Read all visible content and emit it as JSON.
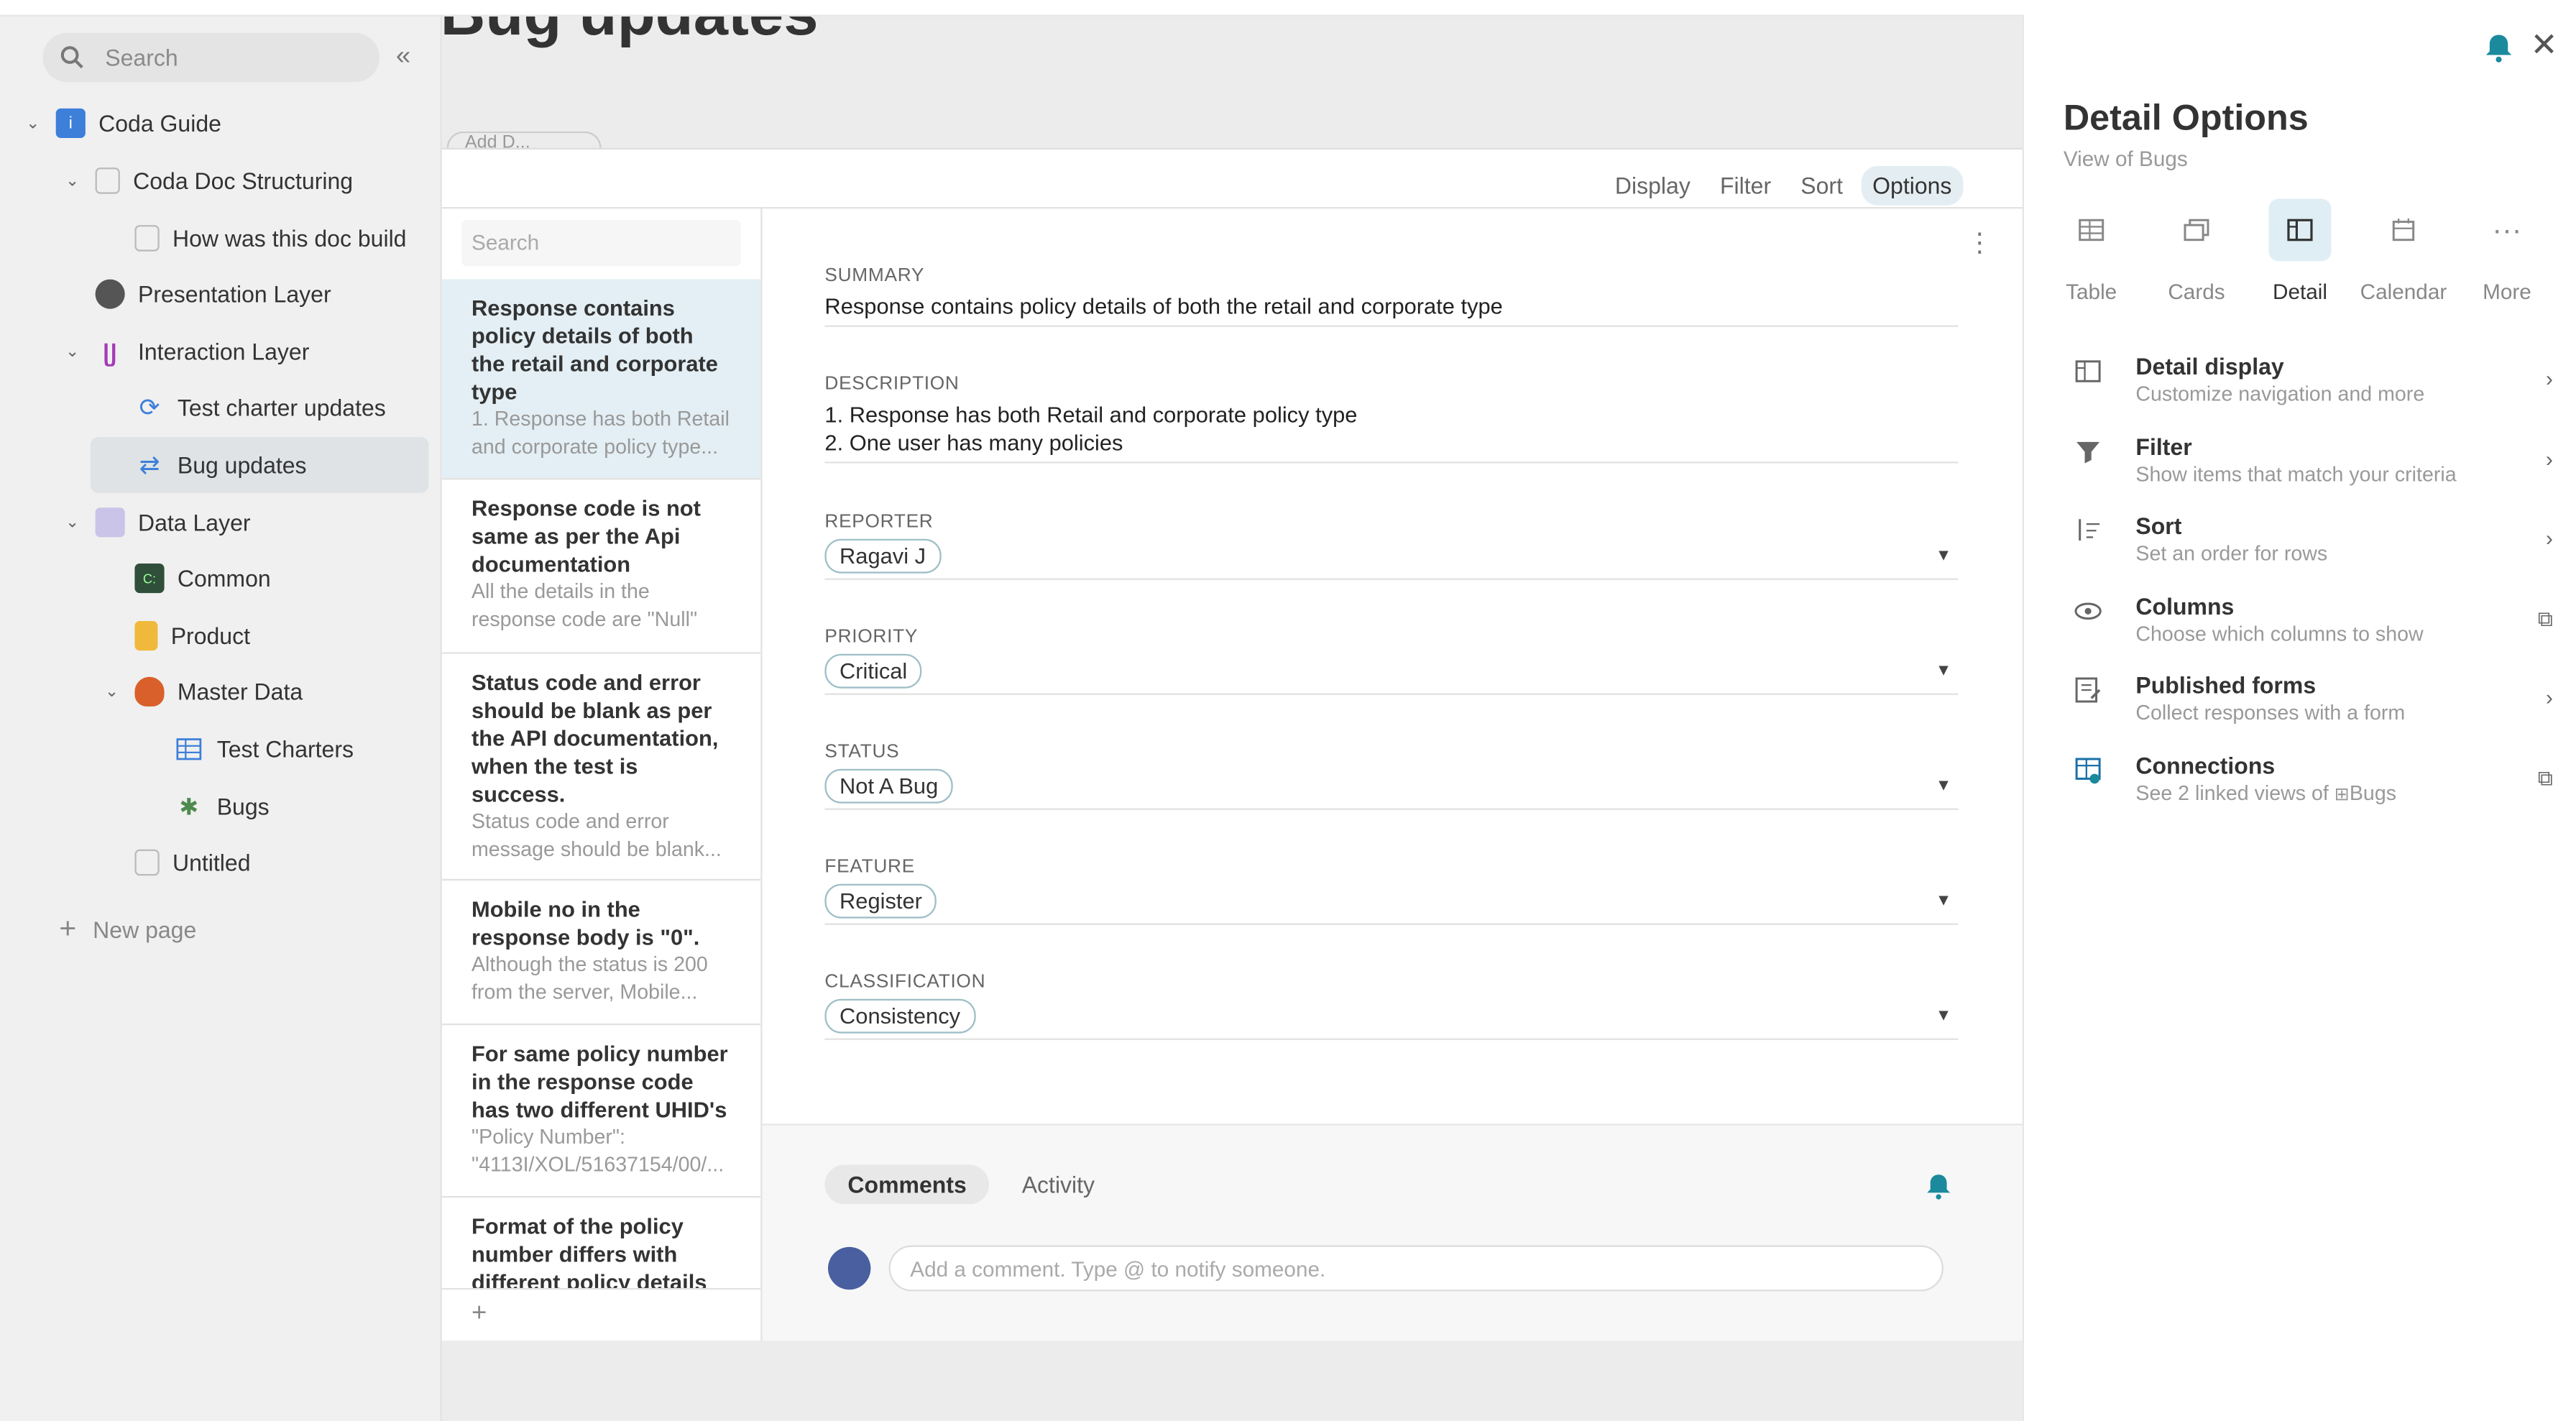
{
  "sidebar": {
    "search_placeholder": "Search",
    "collapse_glyph": "«",
    "new_page": "New page",
    "items": [
      {
        "label": "Coda Guide",
        "icon": "info-icon"
      },
      {
        "label": "Coda Doc Structuring",
        "icon": "doc-icon"
      },
      {
        "label": "How was this doc build",
        "icon": "doc-icon"
      },
      {
        "label": "Presentation Layer",
        "icon": "gauge-icon"
      },
      {
        "label": "Interaction Layer",
        "icon": "wave-icon"
      },
      {
        "label": "Test charter updates",
        "icon": "sync-icon"
      },
      {
        "label": "Bug updates",
        "icon": "sync-icon"
      },
      {
        "label": "Data Layer",
        "icon": "data-icon"
      },
      {
        "label": "Common",
        "icon": "terminal-icon"
      },
      {
        "label": "Product",
        "icon": "file-icon"
      },
      {
        "label": "Master Data",
        "icon": "fox-icon"
      },
      {
        "label": "Test Charters",
        "icon": "table-icon"
      },
      {
        "label": "Bugs",
        "icon": "bug-icon"
      },
      {
        "label": "Untitled",
        "icon": "doc-icon"
      }
    ]
  },
  "page": {
    "title": "Bug updates",
    "add_desc": "Add D..."
  },
  "toolbar": {
    "display": "Display",
    "filter": "Filter",
    "sort": "Sort",
    "options": "Options"
  },
  "list": {
    "search_placeholder": "Search",
    "add": "+",
    "cards": [
      {
        "title": "Response contains policy details of both the retail and corporate type",
        "desc": "1. Response has both Retail and corporate policy type..."
      },
      {
        "title": "Response code is not same as per the Api documentation",
        "desc": "All the details in the response code are \"Null\""
      },
      {
        "title": "Status code and error should be blank as per the API documentation, when the test is success.",
        "desc": "Status code and error message should be blank..."
      },
      {
        "title": "Mobile no in the response body is \"0\".",
        "desc": "Although the status is 200 from the server, Mobile..."
      },
      {
        "title": "For same policy number in the response code has two different UHID's",
        "desc": "\"Policy Number\": \"4113I/XOL/51637154/00/..."
      },
      {
        "title": "Format of the policy number differs with different policy details",
        "desc": ""
      }
    ]
  },
  "detail": {
    "summary_label": "SUMMARY",
    "summary": "Response contains policy details of both the retail and corporate type",
    "description_label": "DESCRIPTION",
    "description_1": "1. Response has both Retail and corporate policy type",
    "description_2": "2. One user has many policies",
    "reporter_label": "REPORTER",
    "reporter": "Ragavi J",
    "priority_label": "PRIORITY",
    "priority": "Critical",
    "status_label": "STATUS",
    "status": "Not A Bug",
    "feature_label": "FEATURE",
    "feature": "Register",
    "classification_label": "CLASSIFICATION",
    "classification": "Consistency"
  },
  "comments": {
    "tab_comments": "Comments",
    "tab_activity": "Activity",
    "placeholder": "Add a comment. Type @ to notify someone."
  },
  "panel": {
    "title": "Detail Options",
    "subtitle": "View of Bugs",
    "views": [
      {
        "label": "Table",
        "icon": "table-icon"
      },
      {
        "label": "Cards",
        "icon": "cards-icon"
      },
      {
        "label": "Detail",
        "icon": "detail-icon"
      },
      {
        "label": "Calendar",
        "icon": "calendar-icon"
      },
      {
        "label": "More",
        "icon": "more-icon"
      }
    ],
    "options": [
      {
        "title": "Detail display",
        "sub": "Customize navigation and more",
        "icon": "layout-icon",
        "arrow": "chevron-right-icon"
      },
      {
        "title": "Filter",
        "sub": "Show items that match your criteria",
        "icon": "filter-icon",
        "arrow": "chevron-right-icon"
      },
      {
        "title": "Sort",
        "sub": "Set an order for rows",
        "icon": "sort-icon",
        "arrow": "chevron-right-icon"
      },
      {
        "title": "Columns",
        "sub": "Choose which columns to show",
        "icon": "eye-icon",
        "arrow": "external-link-icon"
      },
      {
        "title": "Published forms",
        "sub": "Collect responses with a form",
        "icon": "form-icon",
        "arrow": "chevron-right-icon"
      },
      {
        "title": "Connections",
        "sub": "See 2 linked views of",
        "sub_link": "Bugs",
        "icon": "connections-icon",
        "arrow": "external-link-icon"
      }
    ]
  },
  "colors": {
    "accent": "#1a8a9c",
    "selected_card": "#e3eff4",
    "sidebar_bg": "#f0f0f0"
  }
}
